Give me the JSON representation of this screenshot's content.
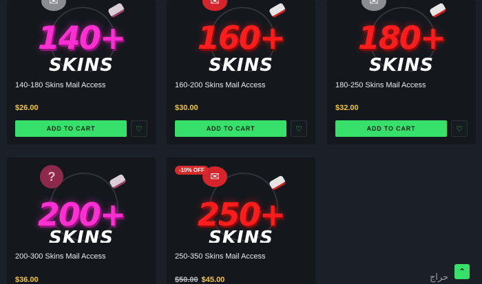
{
  "products": [
    {
      "number": "140+",
      "word": "SKINS",
      "title": "140-180 Skins Mail Access",
      "price": "$26.00",
      "old_price": "",
      "badge": "",
      "button": "ADD TO CART",
      "color": "#ff2fd2"
    },
    {
      "number": "160+",
      "word": "SKINS",
      "title": "160-200 Skins Mail Access",
      "price": "$30.00",
      "old_price": "",
      "badge": "",
      "button": "ADD TO CART",
      "color": "#ff1c1c"
    },
    {
      "number": "180+",
      "word": "SKINS",
      "title": "180-250 Skins Mail Access",
      "price": "$32.00",
      "old_price": "",
      "badge": "",
      "button": "ADD TO CART",
      "color": "#ff1c1c"
    },
    {
      "number": "200+",
      "word": "SKINS",
      "title": "200-300 Skins Mail Access",
      "price": "$36.00",
      "old_price": "",
      "badge": "",
      "button": "ADD TO CART",
      "color": "#ff2fd2"
    },
    {
      "number": "250+",
      "word": "SKINS",
      "title": "250-350 Skins Mail Access",
      "price": "$45.00",
      "old_price": "$50.00",
      "badge": "-10% OFF",
      "button": "ADD TO CART",
      "color": "#ff1c1c"
    }
  ],
  "icons": {
    "wishlist": "heart-icon",
    "scroll_top": "chevron-up-icon",
    "envelope": "envelope-icon",
    "question": "question-icon"
  },
  "glyphs": {
    "heart": "♡",
    "chevron_up": "⌃",
    "envelope": "✉",
    "question": "?"
  },
  "accent": "#37e06b",
  "price_color": "#f3c53c",
  "watermark": "حراج"
}
